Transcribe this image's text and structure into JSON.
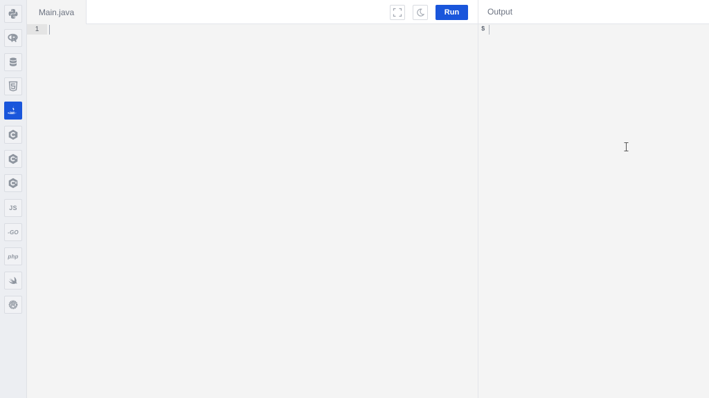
{
  "sidebar": {
    "languages": [
      {
        "name": "python-icon",
        "active": false
      },
      {
        "name": "r-icon",
        "active": false
      },
      {
        "name": "sql-icon",
        "active": false
      },
      {
        "name": "html5-icon",
        "active": false
      },
      {
        "name": "java-icon",
        "active": true
      },
      {
        "name": "c-icon",
        "active": false
      },
      {
        "name": "cpp-icon",
        "active": false
      },
      {
        "name": "csharp-icon",
        "active": false
      },
      {
        "name": "javascript-icon",
        "label": "JS",
        "active": false
      },
      {
        "name": "go-icon",
        "label": "-GO",
        "active": false
      },
      {
        "name": "php-icon",
        "label": "php",
        "active": false
      },
      {
        "name": "swift-icon",
        "active": false
      },
      {
        "name": "rust-icon",
        "active": false
      }
    ]
  },
  "editor": {
    "file_tab": "Main.java",
    "run_label": "Run",
    "line_numbers": [
      "1"
    ],
    "fullscreen_icon": "fullscreen-icon",
    "theme_icon": "moon-icon"
  },
  "output": {
    "title": "Output",
    "prompt": "$"
  },
  "colors": {
    "accent": "#1a56db",
    "background": "#f4f4f4",
    "sidebar": "#eceef2"
  }
}
